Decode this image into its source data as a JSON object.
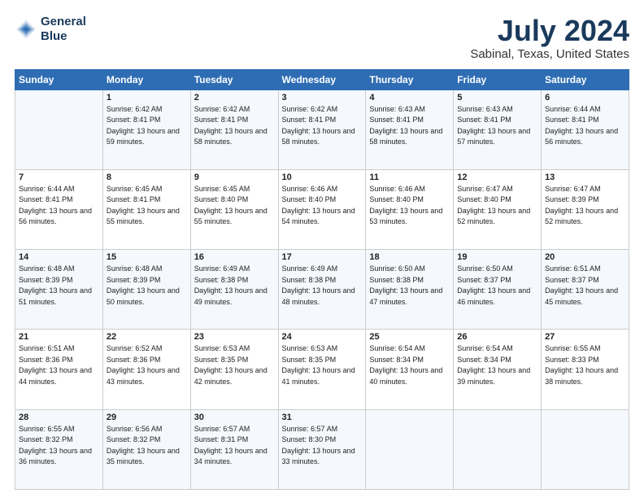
{
  "logo": {
    "line1": "General",
    "line2": "Blue"
  },
  "title": "July 2024",
  "location": "Sabinal, Texas, United States",
  "header_days": [
    "Sunday",
    "Monday",
    "Tuesday",
    "Wednesday",
    "Thursday",
    "Friday",
    "Saturday"
  ],
  "weeks": [
    [
      {
        "day": "",
        "sunrise": "",
        "sunset": "",
        "daylight": ""
      },
      {
        "day": "1",
        "sunrise": "Sunrise: 6:42 AM",
        "sunset": "Sunset: 8:41 PM",
        "daylight": "Daylight: 13 hours and 59 minutes."
      },
      {
        "day": "2",
        "sunrise": "Sunrise: 6:42 AM",
        "sunset": "Sunset: 8:41 PM",
        "daylight": "Daylight: 13 hours and 58 minutes."
      },
      {
        "day": "3",
        "sunrise": "Sunrise: 6:42 AM",
        "sunset": "Sunset: 8:41 PM",
        "daylight": "Daylight: 13 hours and 58 minutes."
      },
      {
        "day": "4",
        "sunrise": "Sunrise: 6:43 AM",
        "sunset": "Sunset: 8:41 PM",
        "daylight": "Daylight: 13 hours and 58 minutes."
      },
      {
        "day": "5",
        "sunrise": "Sunrise: 6:43 AM",
        "sunset": "Sunset: 8:41 PM",
        "daylight": "Daylight: 13 hours and 57 minutes."
      },
      {
        "day": "6",
        "sunrise": "Sunrise: 6:44 AM",
        "sunset": "Sunset: 8:41 PM",
        "daylight": "Daylight: 13 hours and 56 minutes."
      }
    ],
    [
      {
        "day": "7",
        "sunrise": "Sunrise: 6:44 AM",
        "sunset": "Sunset: 8:41 PM",
        "daylight": "Daylight: 13 hours and 56 minutes."
      },
      {
        "day": "8",
        "sunrise": "Sunrise: 6:45 AM",
        "sunset": "Sunset: 8:41 PM",
        "daylight": "Daylight: 13 hours and 55 minutes."
      },
      {
        "day": "9",
        "sunrise": "Sunrise: 6:45 AM",
        "sunset": "Sunset: 8:40 PM",
        "daylight": "Daylight: 13 hours and 55 minutes."
      },
      {
        "day": "10",
        "sunrise": "Sunrise: 6:46 AM",
        "sunset": "Sunset: 8:40 PM",
        "daylight": "Daylight: 13 hours and 54 minutes."
      },
      {
        "day": "11",
        "sunrise": "Sunrise: 6:46 AM",
        "sunset": "Sunset: 8:40 PM",
        "daylight": "Daylight: 13 hours and 53 minutes."
      },
      {
        "day": "12",
        "sunrise": "Sunrise: 6:47 AM",
        "sunset": "Sunset: 8:40 PM",
        "daylight": "Daylight: 13 hours and 52 minutes."
      },
      {
        "day": "13",
        "sunrise": "Sunrise: 6:47 AM",
        "sunset": "Sunset: 8:39 PM",
        "daylight": "Daylight: 13 hours and 52 minutes."
      }
    ],
    [
      {
        "day": "14",
        "sunrise": "Sunrise: 6:48 AM",
        "sunset": "Sunset: 8:39 PM",
        "daylight": "Daylight: 13 hours and 51 minutes."
      },
      {
        "day": "15",
        "sunrise": "Sunrise: 6:48 AM",
        "sunset": "Sunset: 8:39 PM",
        "daylight": "Daylight: 13 hours and 50 minutes."
      },
      {
        "day": "16",
        "sunrise": "Sunrise: 6:49 AM",
        "sunset": "Sunset: 8:38 PM",
        "daylight": "Daylight: 13 hours and 49 minutes."
      },
      {
        "day": "17",
        "sunrise": "Sunrise: 6:49 AM",
        "sunset": "Sunset: 8:38 PM",
        "daylight": "Daylight: 13 hours and 48 minutes."
      },
      {
        "day": "18",
        "sunrise": "Sunrise: 6:50 AM",
        "sunset": "Sunset: 8:38 PM",
        "daylight": "Daylight: 13 hours and 47 minutes."
      },
      {
        "day": "19",
        "sunrise": "Sunrise: 6:50 AM",
        "sunset": "Sunset: 8:37 PM",
        "daylight": "Daylight: 13 hours and 46 minutes."
      },
      {
        "day": "20",
        "sunrise": "Sunrise: 6:51 AM",
        "sunset": "Sunset: 8:37 PM",
        "daylight": "Daylight: 13 hours and 45 minutes."
      }
    ],
    [
      {
        "day": "21",
        "sunrise": "Sunrise: 6:51 AM",
        "sunset": "Sunset: 8:36 PM",
        "daylight": "Daylight: 13 hours and 44 minutes."
      },
      {
        "day": "22",
        "sunrise": "Sunrise: 6:52 AM",
        "sunset": "Sunset: 8:36 PM",
        "daylight": "Daylight: 13 hours and 43 minutes."
      },
      {
        "day": "23",
        "sunrise": "Sunrise: 6:53 AM",
        "sunset": "Sunset: 8:35 PM",
        "daylight": "Daylight: 13 hours and 42 minutes."
      },
      {
        "day": "24",
        "sunrise": "Sunrise: 6:53 AM",
        "sunset": "Sunset: 8:35 PM",
        "daylight": "Daylight: 13 hours and 41 minutes."
      },
      {
        "day": "25",
        "sunrise": "Sunrise: 6:54 AM",
        "sunset": "Sunset: 8:34 PM",
        "daylight": "Daylight: 13 hours and 40 minutes."
      },
      {
        "day": "26",
        "sunrise": "Sunrise: 6:54 AM",
        "sunset": "Sunset: 8:34 PM",
        "daylight": "Daylight: 13 hours and 39 minutes."
      },
      {
        "day": "27",
        "sunrise": "Sunrise: 6:55 AM",
        "sunset": "Sunset: 8:33 PM",
        "daylight": "Daylight: 13 hours and 38 minutes."
      }
    ],
    [
      {
        "day": "28",
        "sunrise": "Sunrise: 6:55 AM",
        "sunset": "Sunset: 8:32 PM",
        "daylight": "Daylight: 13 hours and 36 minutes."
      },
      {
        "day": "29",
        "sunrise": "Sunrise: 6:56 AM",
        "sunset": "Sunset: 8:32 PM",
        "daylight": "Daylight: 13 hours and 35 minutes."
      },
      {
        "day": "30",
        "sunrise": "Sunrise: 6:57 AM",
        "sunset": "Sunset: 8:31 PM",
        "daylight": "Daylight: 13 hours and 34 minutes."
      },
      {
        "day": "31",
        "sunrise": "Sunrise: 6:57 AM",
        "sunset": "Sunset: 8:30 PM",
        "daylight": "Daylight: 13 hours and 33 minutes."
      },
      {
        "day": "",
        "sunrise": "",
        "sunset": "",
        "daylight": ""
      },
      {
        "day": "",
        "sunrise": "",
        "sunset": "",
        "daylight": ""
      },
      {
        "day": "",
        "sunrise": "",
        "sunset": "",
        "daylight": ""
      }
    ]
  ]
}
